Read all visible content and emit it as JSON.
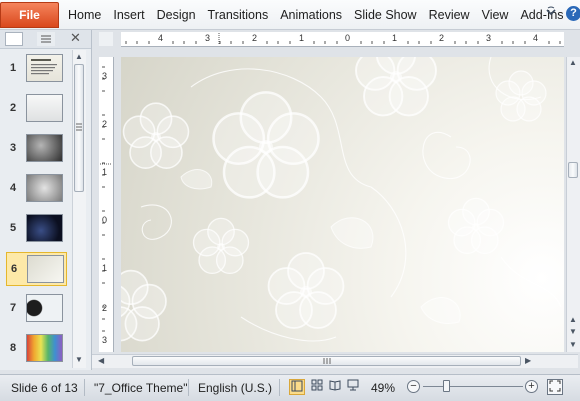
{
  "ribbon": {
    "file_label": "File",
    "tabs": [
      "Home",
      "Insert",
      "Design",
      "Transitions",
      "Animations",
      "Slide Show",
      "Review",
      "View",
      "Add-Ins"
    ],
    "help_glyph": "?",
    "minimize_icon": "chevron-heart-icon"
  },
  "thumbnails": {
    "numbers": [
      "1",
      "2",
      "3",
      "4",
      "5",
      "6",
      "7",
      "8"
    ],
    "active_index": 6
  },
  "rulers": {
    "h_ticks": [
      "4",
      "3",
      "2",
      "1",
      "0",
      "1",
      "2",
      "3",
      "4"
    ],
    "v_ticks": [
      "3",
      "2",
      "1",
      "0",
      "1",
      "2",
      "3"
    ]
  },
  "status": {
    "slide_info": "Slide 6 of 13",
    "theme": "\"7_Office Theme\"",
    "language": "English (U.S.)",
    "zoom": "49%",
    "zoom_value_percent": 49
  },
  "colors": {
    "file_tab": "#d9481d",
    "active_thumb": "#fde9a8",
    "accent_blue": "#2b69b8"
  }
}
